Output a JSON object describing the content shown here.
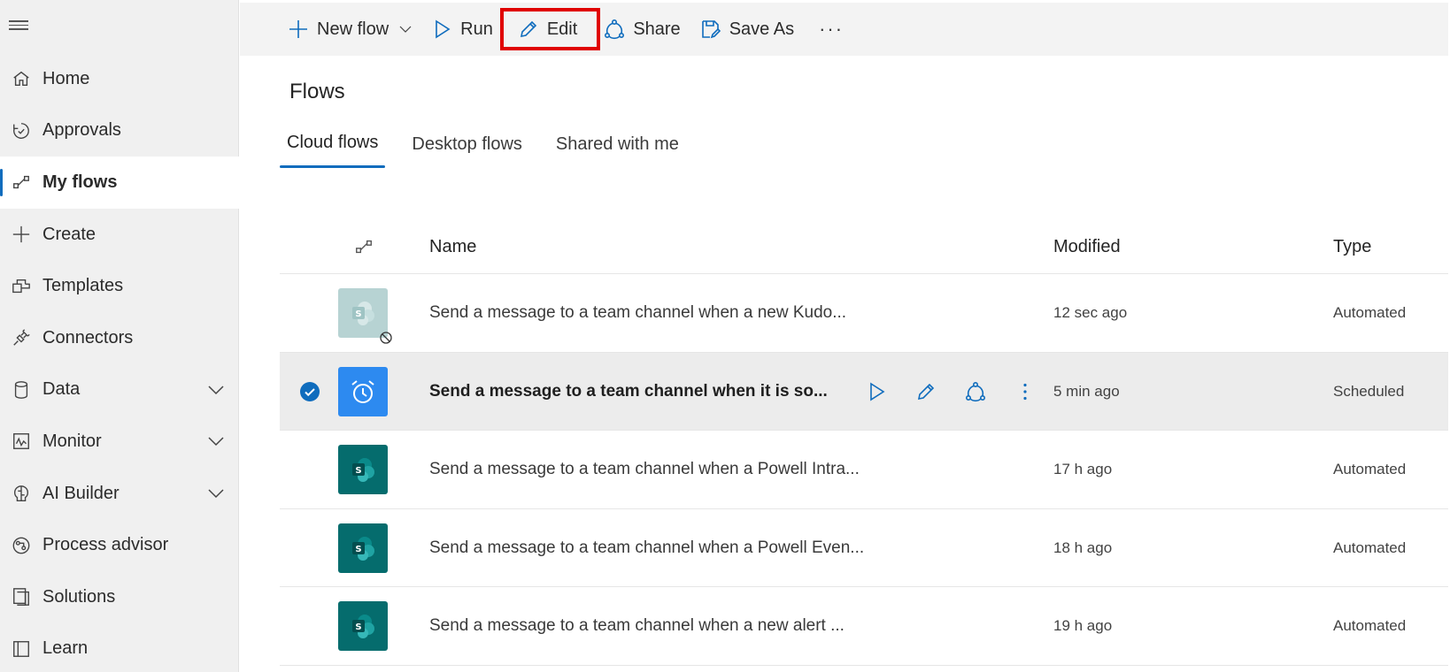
{
  "colors": {
    "accent": "#0f6cbd",
    "highlight": "#e00000",
    "sharepoint_tile": "#056c6d",
    "schedule_tile": "#2d8af0"
  },
  "sidebar": {
    "items": [
      {
        "label": "Home",
        "icon": "home-icon"
      },
      {
        "label": "Approvals",
        "icon": "approvals-icon"
      },
      {
        "label": "My flows",
        "icon": "flows-icon",
        "active": true
      },
      {
        "label": "Create",
        "icon": "plus-icon"
      },
      {
        "label": "Templates",
        "icon": "templates-icon"
      },
      {
        "label": "Connectors",
        "icon": "connectors-icon"
      },
      {
        "label": "Data",
        "icon": "database-icon",
        "expandable": true
      },
      {
        "label": "Monitor",
        "icon": "monitor-icon",
        "expandable": true
      },
      {
        "label": "AI Builder",
        "icon": "ai-builder-icon",
        "expandable": true
      },
      {
        "label": "Process advisor",
        "icon": "process-advisor-icon"
      },
      {
        "label": "Solutions",
        "icon": "solutions-icon"
      },
      {
        "label": "Learn",
        "icon": "book-icon"
      }
    ]
  },
  "toolbar": {
    "new_flow": "New flow",
    "run": "Run",
    "edit": "Edit",
    "share": "Share",
    "save_as": "Save As",
    "more": "···"
  },
  "page": {
    "title": "Flows"
  },
  "tabs": [
    {
      "label": "Cloud flows",
      "active": true
    },
    {
      "label": "Desktop flows"
    },
    {
      "label": "Shared with me"
    }
  ],
  "table": {
    "headers": {
      "name": "Name",
      "modified": "Modified",
      "type": "Type"
    },
    "rows": [
      {
        "name": "Send a message to a team channel when a new Kudo...",
        "modified": "12 sec ago",
        "type": "Automated"
      },
      {
        "name": "Send a message to a team channel when it is so...",
        "modified": "5 min ago",
        "type": "Scheduled"
      },
      {
        "name": "Send a message to a team channel when a Powell Intra...",
        "modified": "17 h ago",
        "type": "Automated"
      },
      {
        "name": "Send a message to a team channel when a Powell Even...",
        "modified": "18 h ago",
        "type": "Automated"
      },
      {
        "name": "Send a message to a team channel when a new alert ...",
        "modified": "19 h ago",
        "type": "Automated"
      }
    ]
  }
}
